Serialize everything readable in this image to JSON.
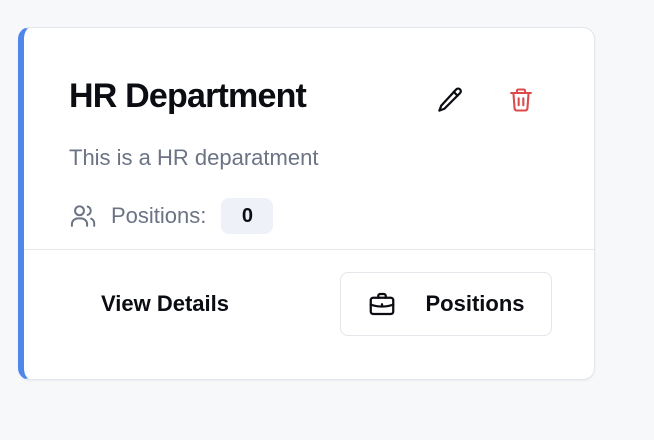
{
  "card": {
    "title": "HR Department",
    "description": "This is a HR deparatment",
    "positions_label": "Positions:",
    "positions_count": "0",
    "accent_color": "#4f86ee",
    "delete_color": "#dc4b4b"
  },
  "actions": {
    "edit_icon": "pencil-icon",
    "delete_icon": "trash-icon",
    "view_details_label": "View Details",
    "positions_button_label": "Positions",
    "positions_button_icon": "briefcase-icon"
  }
}
